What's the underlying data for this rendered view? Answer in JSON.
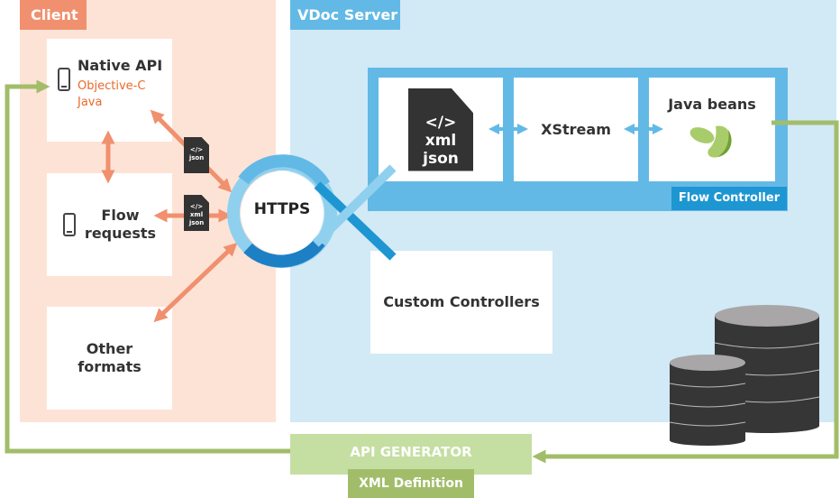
{
  "client": {
    "title": "Client",
    "native_api": {
      "title": "Native API",
      "languages": [
        "Objective-C",
        "Java"
      ]
    },
    "flow_requests": {
      "title_line1": "Flow",
      "title_line2": "requests"
    },
    "other_formats": {
      "title_line1": "Other",
      "title_line2": "formats"
    },
    "doc_badges": [
      {
        "icon": "code-document-icon",
        "lines": [
          "</>",
          "json"
        ]
      },
      {
        "icon": "code-document-icon",
        "lines": [
          "</>",
          "xml",
          "json"
        ]
      }
    ]
  },
  "https": {
    "label": "HTTPS"
  },
  "server": {
    "title": "VDoc Server",
    "flow_controller": {
      "label": "Flow Controller",
      "document": {
        "lines": [
          "</>",
          "xml",
          "json"
        ]
      },
      "xstream": "XStream",
      "java_beans": "Java beans"
    },
    "custom_controllers": "Custom Controllers"
  },
  "api_generator": {
    "label": "API GENERATOR",
    "definition": "XML Definition"
  },
  "colors": {
    "client_bg": "#fde3d6",
    "client_accent": "#f0906e",
    "server_bg": "#d2e9f6",
    "server_accent": "#63b9e5",
    "server_dark": "#1e96d2",
    "generator_light": "#c5dea2",
    "generator_dark": "#a2bd6a",
    "language_text": "#e8692c"
  }
}
